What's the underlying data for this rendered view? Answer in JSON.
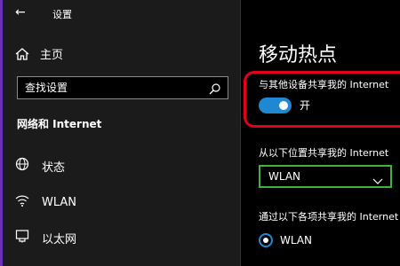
{
  "window": {
    "back_icon": "←",
    "title": "设置"
  },
  "sidebar": {
    "home_label": "主页",
    "search_placeholder": "查找设置",
    "section_title": "网络和 Internet",
    "items": [
      {
        "label": "状态",
        "icon": "globe-icon"
      },
      {
        "label": "WLAN",
        "icon": "wifi-icon"
      },
      {
        "label": "以太网",
        "icon": "ethernet-icon"
      }
    ]
  },
  "main": {
    "title": "移动热点",
    "share_label": "与其他设备共享我的 Internet",
    "toggle_state": "开",
    "share_from_label": "从以下位置共享我的 Internet",
    "share_from_value": "WLAN",
    "share_over_label": "通过以下各项共享我的 Internet",
    "share_over_option": "WLAN"
  },
  "colors": {
    "accent": "#1e88d2",
    "highlight_red": "#e3001b",
    "highlight_green": "#3db53d",
    "sidebar_bg": "#1b1b1b",
    "main_bg": "#000000"
  }
}
